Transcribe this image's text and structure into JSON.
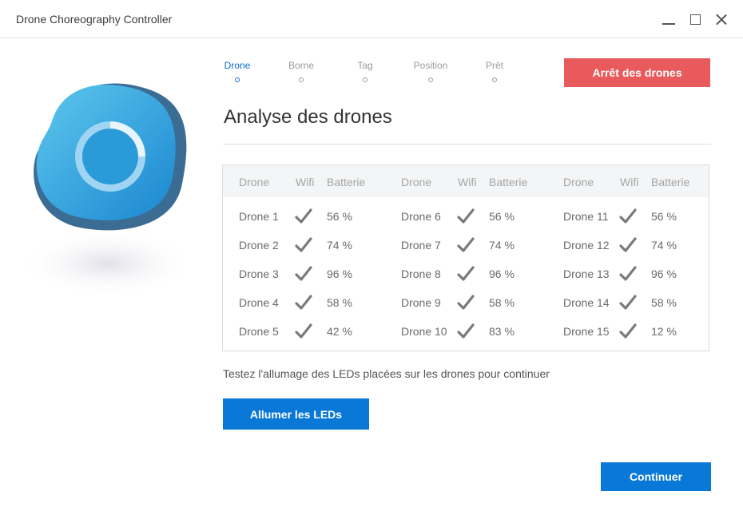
{
  "window": {
    "title": "Drone Choreography Controller"
  },
  "stepper": [
    {
      "label": "Drone",
      "active": true
    },
    {
      "label": "Borne",
      "active": false
    },
    {
      "label": "Tag",
      "active": false
    },
    {
      "label": "Position",
      "active": false
    },
    {
      "label": "Prêt",
      "active": false
    }
  ],
  "stop_button": "Arrêt des drones",
  "page_title": "Analyse des drones",
  "table": {
    "headers": {
      "drone": "Drone",
      "wifi": "Wifi",
      "battery": "Batterie"
    },
    "columns": [
      [
        {
          "name": "Drone 1",
          "wifi": true,
          "battery": "56 %"
        },
        {
          "name": "Drone 2",
          "wifi": true,
          "battery": "74 %"
        },
        {
          "name": "Drone 3",
          "wifi": true,
          "battery": "96 %"
        },
        {
          "name": "Drone 4",
          "wifi": true,
          "battery": "58 %"
        },
        {
          "name": "Drone 5",
          "wifi": true,
          "battery": "42 %"
        }
      ],
      [
        {
          "name": "Drone 6",
          "wifi": true,
          "battery": "56 %"
        },
        {
          "name": "Drone 7",
          "wifi": true,
          "battery": "74 %"
        },
        {
          "name": "Drone 8",
          "wifi": true,
          "battery": "96 %"
        },
        {
          "name": "Drone 9",
          "wifi": true,
          "battery": "58 %"
        },
        {
          "name": "Drone 10",
          "wifi": true,
          "battery": "83 %"
        }
      ],
      [
        {
          "name": "Drone 11",
          "wifi": true,
          "battery": "56 %"
        },
        {
          "name": "Drone 12",
          "wifi": true,
          "battery": "74 %"
        },
        {
          "name": "Drone 13",
          "wifi": true,
          "battery": "96 %"
        },
        {
          "name": "Drone 14",
          "wifi": true,
          "battery": "58 %"
        },
        {
          "name": "Drone 15",
          "wifi": true,
          "battery": "12 %"
        }
      ]
    ]
  },
  "hint": "Testez l'allumage des LEDs placées sur les drones pour continuer",
  "led_button": "Allumer les LEDs",
  "continue_button": "Continuer",
  "colors": {
    "accent": "#0a78d7",
    "danger": "#e85a5b",
    "active_step": "#0a6fd0",
    "check": "#7a7a7a"
  },
  "icons": {
    "wifi_ok": "check-icon",
    "logo": "app-logo"
  }
}
